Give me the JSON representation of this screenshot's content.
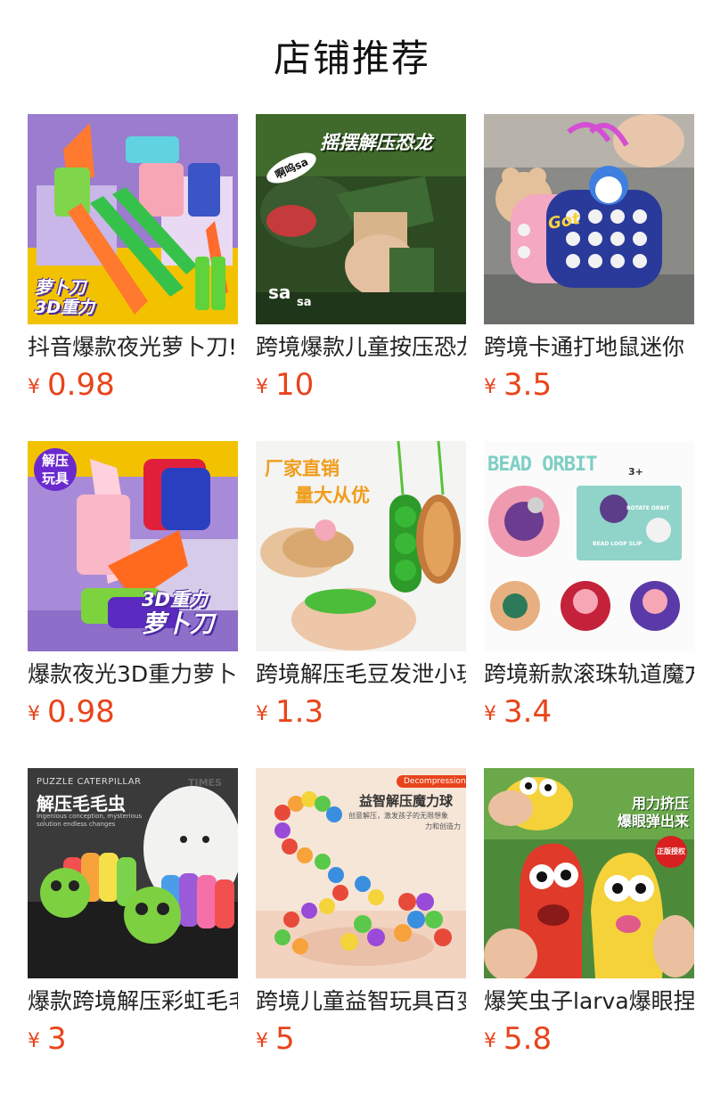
{
  "page": {
    "title": "店铺推荐"
  },
  "currency_symbol": "¥",
  "accent_color": "#e8441b",
  "products": [
    {
      "name": "抖音爆款夜光萝卜刀!",
      "price": "0.98",
      "image_text": [
        "萝卜刀",
        "3D重力"
      ]
    },
    {
      "name": "跨境爆款儿童按压恐龙",
      "price": "10",
      "image_text": [
        "摇摆解压恐龙",
        "啊呜sa",
        "sa",
        "sa"
      ]
    },
    {
      "name": "跨境卡通打地鼠迷你",
      "price": "3.5",
      "image_text": [
        "Got"
      ]
    },
    {
      "name": "爆款夜光3D重力萝卜",
      "price": "0.98",
      "image_text": [
        "解压",
        "玩具",
        "3D重力",
        "萝卜刀"
      ]
    },
    {
      "name": "跨境解压毛豆发泄小玩",
      "price": "1.3",
      "image_text": [
        "厂家直销",
        "量大从优"
      ]
    },
    {
      "name": "跨境新款滚珠轨道魔方",
      "price": "3.4",
      "image_text": [
        "BEAD ORBIT",
        "3+",
        "ROTATE ORBIT",
        "BEAD LOOP SLIP"
      ]
    },
    {
      "name": "爆款跨境解压彩虹毛毛",
      "price": "3",
      "image_text": [
        "PUZZLE CATERPILLAR",
        "解压毛毛虫",
        "Ingenious conception, mysterious",
        "solution endless changes",
        "TIMES"
      ]
    },
    {
      "name": "跨境儿童益智玩具百变",
      "price": "5",
      "image_text": [
        "Decompression",
        "益智解压魔力球",
        "创意解压，激发孩子的无限想象",
        "力和创造力"
      ]
    },
    {
      "name": "爆笑虫子larva爆眼捏",
      "price": "5.8",
      "image_text": [
        "用力挤压",
        "爆眼弹出来",
        "正版授权"
      ]
    }
  ]
}
